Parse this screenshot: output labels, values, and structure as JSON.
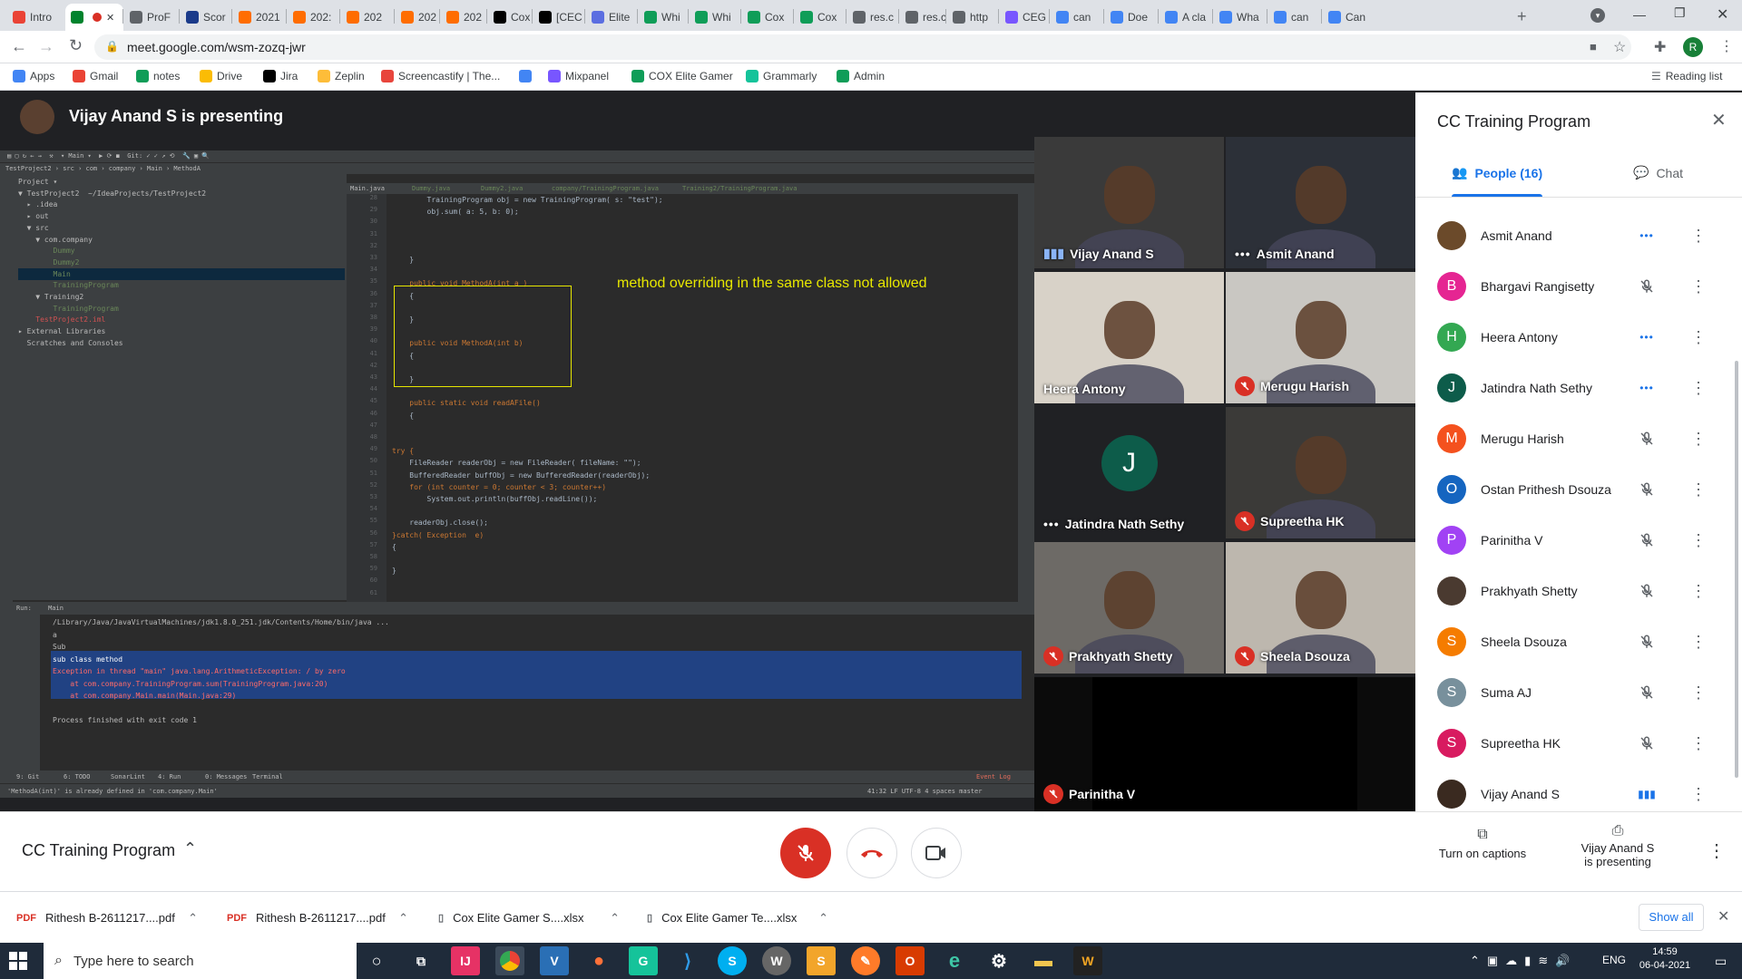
{
  "browser": {
    "tabs": [
      {
        "label": "Intro",
        "icon": "gmail-icon",
        "color": "#ea4335"
      },
      {
        "label": "",
        "icon": "meet-icon",
        "color": "#00832d",
        "active": true
      },
      {
        "label": "ProF",
        "icon": "globe-icon",
        "color": "#5f6368"
      },
      {
        "label": "Scor",
        "icon": "p-icon",
        "color": "#1a3a8a"
      },
      {
        "label": "2021",
        "icon": "pinwheel-icon",
        "color": "#ff6d01"
      },
      {
        "label": "202:",
        "icon": "pinwheel-icon",
        "color": "#ff6d01"
      },
      {
        "label": "202",
        "icon": "pinwheel-icon",
        "color": "#ff6d01"
      },
      {
        "label": "202",
        "icon": "pinwheel-icon",
        "color": "#ff6d01"
      },
      {
        "label": "202",
        "icon": "pinwheel-icon",
        "color": "#ff6d01"
      },
      {
        "label": "Cox",
        "icon": "jira-icon",
        "color": "#000"
      },
      {
        "label": "[CEC",
        "icon": "jira-icon",
        "color": "#000"
      },
      {
        "label": "Elite",
        "icon": "star-icon",
        "color": "#5b6ee1"
      },
      {
        "label": "Whi",
        "icon": "drive-icon",
        "color": "#0f9d58"
      },
      {
        "label": "Whi",
        "icon": "sheets-icon",
        "color": "#0f9d58"
      },
      {
        "label": "Cox",
        "icon": "sheets-icon",
        "color": "#0f9d58"
      },
      {
        "label": "Cox",
        "icon": "sheets-icon",
        "color": "#0f9d58"
      },
      {
        "label": "res.c",
        "icon": "globe-icon",
        "color": "#5f6368"
      },
      {
        "label": "res.c",
        "icon": "globe-icon",
        "color": "#5f6368"
      },
      {
        "label": "http",
        "icon": "globe-icon",
        "color": "#5f6368"
      },
      {
        "label": "CEG",
        "icon": "mixpanel-icon",
        "color": "#7856ff"
      },
      {
        "label": "can",
        "icon": "google-icon",
        "color": "#4285f4"
      },
      {
        "label": "Doe",
        "icon": "google-icon",
        "color": "#4285f4"
      },
      {
        "label": "A cla",
        "icon": "google-icon",
        "color": "#4285f4"
      },
      {
        "label": "Wha",
        "icon": "google-icon",
        "color": "#4285f4"
      },
      {
        "label": "can",
        "icon": "google-icon",
        "color": "#4285f4"
      },
      {
        "label": "Can",
        "icon": "google-icon",
        "color": "#4285f4"
      }
    ],
    "new_tab": "+",
    "url": "meet.google.com/wsm-zozq-jwr",
    "profile_initial": "R",
    "bookmarks": [
      {
        "label": "Apps",
        "icon": "apps-grid-icon",
        "color": "#4285f4"
      },
      {
        "label": "Gmail",
        "icon": "gmail-icon",
        "color": "#ea4335"
      },
      {
        "label": "notes",
        "icon": "sheets-icon",
        "color": "#0f9d58"
      },
      {
        "label": "Drive",
        "icon": "drive-icon",
        "color": "#fbbc04"
      },
      {
        "label": "Jira",
        "icon": "jira-icon",
        "color": "#000"
      },
      {
        "label": "Zeplin",
        "icon": "zeplin-icon",
        "color": "#fdbd39"
      },
      {
        "label": "Screencastify | The...",
        "icon": "screencastify-icon",
        "color": "#e8453c"
      },
      {
        "label": "",
        "icon": "translate-icon",
        "color": "#4285f4"
      },
      {
        "label": "Mixpanel",
        "icon": "mixpanel-icon",
        "color": "#7856ff"
      },
      {
        "label": "COX Elite Gamer",
        "icon": "sheets-icon",
        "color": "#0f9d58"
      },
      {
        "label": "Grammarly",
        "icon": "grammarly-icon",
        "color": "#15c39a"
      },
      {
        "label": "Admin",
        "icon": "sheets-icon",
        "color": "#0f9d58"
      }
    ],
    "reading_list": "Reading list"
  },
  "meet": {
    "presenter_banner": "Vijay Anand S is presenting",
    "meeting_name": "CC Training Program",
    "captions_label": "Turn on captions",
    "presenting_label_1": "Vijay Anand S",
    "presenting_label_2": "is presenting",
    "tiles": [
      {
        "name": "Vijay Anand S",
        "status": "speaking",
        "bg": "#3a3a3a"
      },
      {
        "name": "Asmit Anand",
        "status": "more",
        "bg": "#2c3038"
      },
      {
        "name": "Heera Antony",
        "status": "none",
        "bg": "#d8d2c8"
      },
      {
        "name": "Merugu Harish",
        "status": "muted",
        "bg": "#c9c7c2"
      },
      {
        "name": "Jatindra Nath Sethy",
        "status": "more",
        "bg": "#202124",
        "initial": "J",
        "avatar_color": "#0d5c4a"
      },
      {
        "name": "Supreetha HK",
        "status": "muted",
        "bg": "#3b3a38"
      },
      {
        "name": "Prakhyath Shetty",
        "status": "muted",
        "bg": "#6d6a66"
      },
      {
        "name": "Sheela Dsouza",
        "status": "muted",
        "bg": "#bdb7ae"
      },
      {
        "name": "Parinitha V",
        "status": "muted",
        "bg": "#0b0b0b"
      }
    ],
    "panel": {
      "title": "CC Training Program",
      "people_tab": "People (16)",
      "chat_tab": "Chat",
      "people": [
        {
          "name": "Asmit Anand",
          "initial": "",
          "color": "#6b4a2a",
          "status": "more"
        },
        {
          "name": "Bhargavi Rangisetty",
          "initial": "B",
          "color": "#e52592",
          "status": "muted"
        },
        {
          "name": "Heera Antony",
          "initial": "H",
          "color": "#33a852",
          "status": "more"
        },
        {
          "name": "Jatindra Nath Sethy",
          "initial": "J",
          "color": "#0d5c4a",
          "status": "more"
        },
        {
          "name": "Merugu Harish",
          "initial": "M",
          "color": "#f4511e",
          "status": "muted"
        },
        {
          "name": "Ostan Prithesh Dsouza",
          "initial": "O",
          "color": "#1565c0",
          "status": "muted"
        },
        {
          "name": "Parinitha V",
          "initial": "P",
          "color": "#a142f4",
          "status": "muted"
        },
        {
          "name": "Prakhyath Shetty",
          "initial": "",
          "color": "#4a3a30",
          "status": "muted"
        },
        {
          "name": "Sheela Dsouza",
          "initial": "S",
          "color": "#f57c00",
          "status": "muted"
        },
        {
          "name": "Suma AJ",
          "initial": "S",
          "color": "#78909c",
          "status": "muted"
        },
        {
          "name": "Supreetha HK",
          "initial": "S",
          "color": "#d81b60",
          "status": "muted"
        },
        {
          "name": "Vijay Anand S",
          "initial": "",
          "color": "#3a2a20",
          "status": "speaking"
        }
      ]
    }
  },
  "ide": {
    "annotation": "method overriding in the same class not allowed",
    "project_tree": [
      "Project ▾",
      "▼ TestProject2  ~/IdeaProjects/TestProject2",
      "  ▸ .idea",
      "  ▸ out",
      "  ▼ src",
      "    ▼ com.company",
      "        Dummy",
      "        Dummy2",
      "        Main",
      "        TrainingProgram",
      "    ▼ Training2",
      "        TrainingProgram",
      "    TestProject2.iml",
      "▸ External Libraries",
      "  Scratches and Consoles"
    ],
    "editor_tabs": [
      "Main.java",
      "Dummy.java",
      "Dummy2.java",
      "company/TrainingProgram.java",
      "Training2/TrainingProgram.java"
    ],
    "line_numbers": [
      "28",
      "29",
      "30",
      "31",
      "32",
      "33",
      "34",
      "35",
      "36",
      "37",
      "38",
      "39",
      "40",
      "41",
      "42",
      "43",
      "44",
      "45",
      "46",
      "47",
      "48",
      "49",
      "50",
      "51",
      "52",
      "53",
      "54",
      "55",
      "56",
      "57",
      "58",
      "59",
      "60",
      "61"
    ],
    "code_lines": [
      "        TrainingProgram obj = new TrainingProgram( s: \"test\");",
      "        obj.sum( a: 5, b: 0);",
      "",
      "",
      "",
      "    }",
      "",
      "    public void MethodA(int a )",
      "    {",
      "",
      "    }",
      "",
      "    public void MethodA(int b)",
      "    {",
      "",
      "    }",
      "",
      "    public static void readAFile()",
      "    {",
      "",
      "",
      "try {",
      "    FileReader readerObj = new FileReader( fileName: \"\");",
      "    BufferedReader buffObj = new BufferedReader(readerObj);",
      "    for (int counter = 0; counter < 3; counter++)",
      "        System.out.println(buffObj.readLine());",
      "",
      "    readerObj.close();",
      "}catch( Exception  e)",
      "{",
      "",
      "}"
    ],
    "run_label": "Run:",
    "run_tab": "Main",
    "console": [
      "/Library/Java/JavaVirtualMachines/jdk1.8.0_251.jdk/Contents/Home/bin/java ...",
      "a",
      "Sub",
      "sub class method",
      "Exception in thread \"main\" java.lang.ArithmeticException: / by zero",
      "    at com.company.TrainingProgram.sum(TrainingProgram.java:20)",
      "    at com.company.Main.main(Main.java:29)",
      "",
      "Process finished with exit code 1"
    ],
    "bottom_tabs": [
      "9: Git",
      "6: TODO",
      "SonarLint",
      "4: Run",
      "0: Messages",
      "Terminal"
    ],
    "event_log": "Event Log",
    "status_left": "'MethodA(int)' is already defined in 'com.company.Main'",
    "status_right": "41:32  LF  UTF-8  4 spaces  master"
  },
  "downloads": [
    {
      "name": "Rithesh B-2611217....pdf",
      "type": "pdf"
    },
    {
      "name": "Rithesh B-2611217....pdf",
      "type": "pdf"
    },
    {
      "name": "Cox Elite Gamer S....xlsx",
      "type": "xlsx"
    },
    {
      "name": "Cox Elite Gamer Te....xlsx",
      "type": "xlsx"
    }
  ],
  "show_all": "Show all",
  "taskbar": {
    "search_placeholder": "Type here to search",
    "time": "14:59",
    "date": "06-04-2021",
    "lang": "ENG"
  }
}
